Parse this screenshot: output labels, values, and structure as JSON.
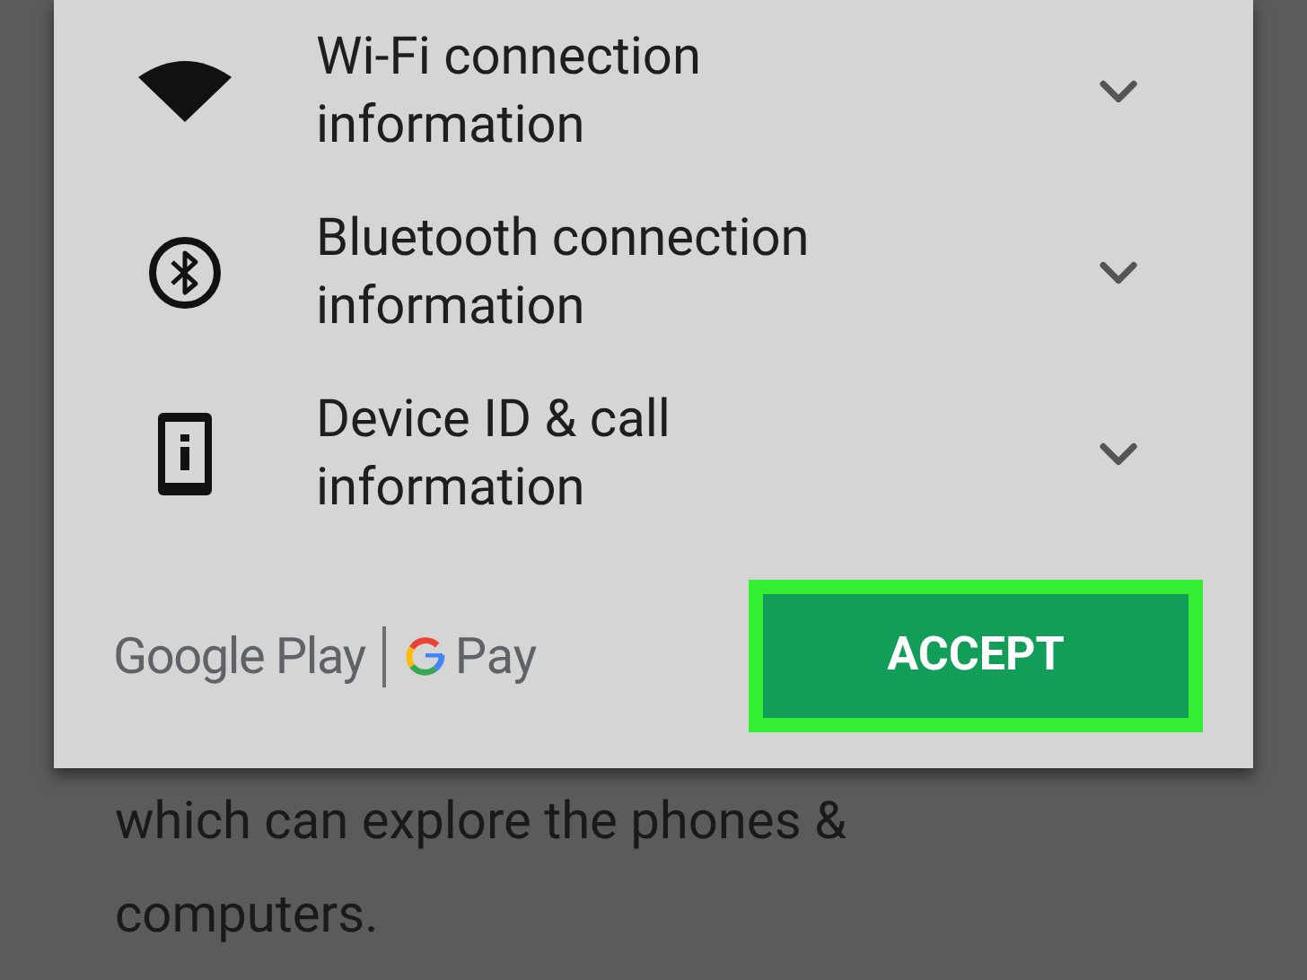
{
  "permissions": [
    {
      "kind": "wifi",
      "label": "Wi-Fi connection information",
      "expanded": false
    },
    {
      "kind": "bluetooth",
      "label": "Bluetooth connection information",
      "expanded": false
    },
    {
      "kind": "device",
      "label": "Device ID & call information",
      "expanded": false
    }
  ],
  "footer": {
    "brand": "Google Play",
    "pay_brand": "Pay"
  },
  "accept_button": {
    "label": "ACCEPT",
    "highlighted": true
  },
  "background_text": "which can explore the phones & computers."
}
